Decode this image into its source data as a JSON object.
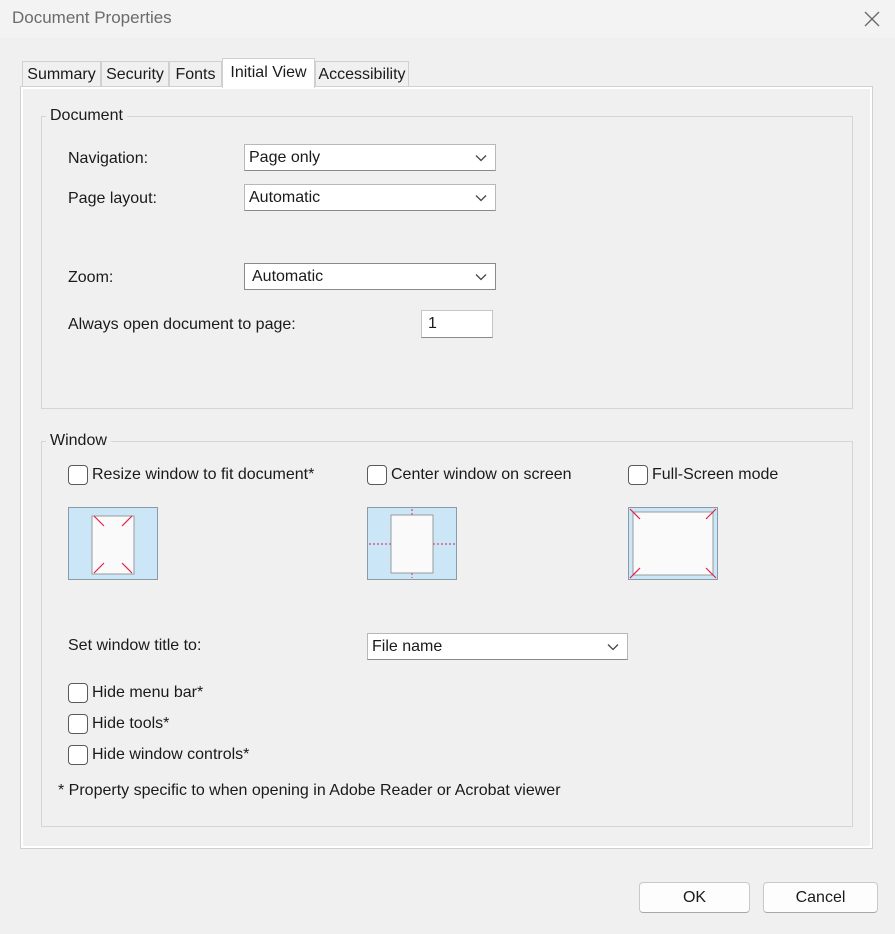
{
  "window": {
    "title": "Document Properties",
    "close_icon": "close-icon"
  },
  "tabs": [
    {
      "label": "Summary",
      "active": false
    },
    {
      "label": "Security",
      "active": false
    },
    {
      "label": "Fonts",
      "active": false
    },
    {
      "label": "Initial View",
      "active": true
    },
    {
      "label": "Accessibility",
      "active": false
    }
  ],
  "document_group": {
    "label": "Document",
    "navigation": {
      "label": "Navigation:",
      "value": "Page only"
    },
    "page_layout": {
      "label": "Page layout:",
      "value": "Automatic"
    },
    "zoom": {
      "label": "Zoom:",
      "value": "Automatic"
    },
    "open_to_page": {
      "label": "Always open document to page:",
      "value": "1"
    }
  },
  "window_group": {
    "label": "Window",
    "resize": {
      "label": "Resize window to fit document*",
      "checked": false
    },
    "center": {
      "label": "Center window on screen",
      "checked": false
    },
    "fullscreen": {
      "label": "Full-Screen mode",
      "checked": false
    },
    "window_title": {
      "label": "Set window title to:",
      "value": "File name"
    },
    "hide_menu_bar": {
      "label": "Hide menu bar*",
      "checked": false
    },
    "hide_tools": {
      "label": "Hide tools*",
      "checked": false
    },
    "hide_window_controls": {
      "label": "Hide window controls*",
      "checked": false
    },
    "footnote": "* Property specific to when opening in Adobe Reader or Acrobat viewer"
  },
  "buttons": {
    "ok": "OK",
    "cancel": "Cancel"
  },
  "colors": {
    "preview_bg": "#cbe6f6",
    "preview_marker": "#e0204b",
    "active_tab": "#ffffff",
    "dialog_bg": "#f0f0f0"
  }
}
